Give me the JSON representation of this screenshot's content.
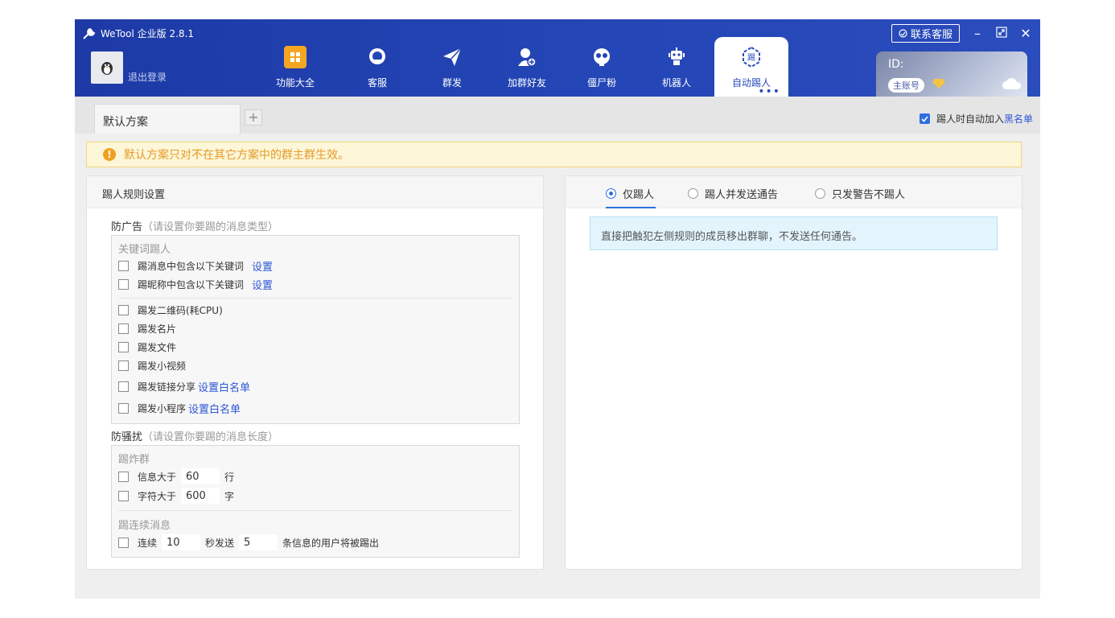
{
  "app": {
    "title": "WeTool 企业版 2.8.1"
  },
  "header": {
    "logout": "退出登录",
    "nav": [
      {
        "label": "功能大全",
        "icon": "apps-grid-icon"
      },
      {
        "label": "客服",
        "icon": "headset-icon"
      },
      {
        "label": "群发",
        "icon": "paper-plane-icon"
      },
      {
        "label": "加群好友",
        "icon": "add-user-icon"
      },
      {
        "label": "僵尸粉",
        "icon": "skull-icon"
      },
      {
        "label": "机器人",
        "icon": "robot-icon"
      },
      {
        "label": "自动踢人",
        "icon": "kick-icon"
      }
    ],
    "contact": "联系客服",
    "account": {
      "id_label": "ID:",
      "badge": "主账号"
    }
  },
  "tabs": {
    "default": "默认方案",
    "add": "+"
  },
  "blacklist": {
    "prefix": "踢人时自动加入",
    "link": "黑名单"
  },
  "warning": "默认方案只对不在其它方案中的群主群生效。",
  "left": {
    "title": "踢人规则设置",
    "ad": {
      "title": "防广告",
      "hint": "（请设置你要踢的消息类型）",
      "keyword_group": "关键词踢人",
      "rows": [
        {
          "label": "踢消息中包含以下关键词",
          "link": "设置"
        },
        {
          "label": "踢昵称中包含以下关键词",
          "link": "设置"
        },
        {
          "label": "踢发二维码(耗CPU)"
        },
        {
          "label": "踢发名片"
        },
        {
          "label": "踢发文件"
        },
        {
          "label": "踢发小视频"
        },
        {
          "label": "踢发链接分享",
          "link": "设置白名单"
        },
        {
          "label": "踢发小程序",
          "link": "设置白名单"
        }
      ]
    },
    "harass": {
      "title": "防骚扰",
      "hint": "（请设置你要踢的消息长度）",
      "bomb_group": "踢炸群",
      "msg_prefix": "信息大于",
      "msg_value": "60",
      "msg_unit": "行",
      "char_prefix": "字符大于",
      "char_value": "600",
      "char_unit": "字",
      "consecutive_group": "踢连续消息",
      "cons_prefix": "连续",
      "cons_seconds": "10",
      "cons_mid": "秒发送",
      "cons_count": "5",
      "cons_suffix": "条信息的用户将被踢出"
    }
  },
  "right": {
    "options": [
      "仅踢人",
      "踢人并发送通告",
      "只发警告不踢人"
    ],
    "selected": "仅踢人",
    "info": "直接把触犯左侧规则的成员移出群聊，不发送任何通告。"
  },
  "colors": {
    "header": "#2345b5",
    "accent": "#2d6ee0",
    "warning": "#e59b27",
    "nav_icon_active": "#f5a623"
  }
}
